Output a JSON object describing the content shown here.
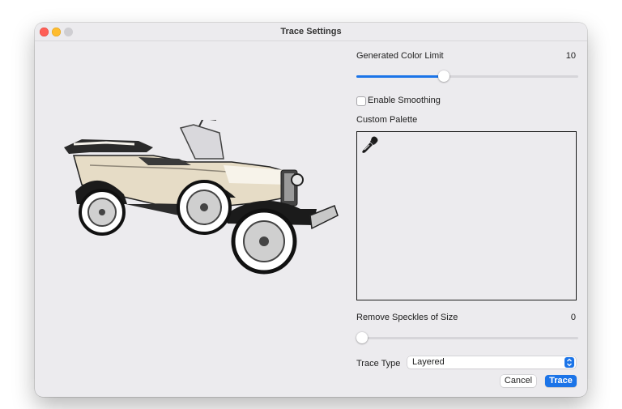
{
  "window": {
    "title": "Trace Settings"
  },
  "color_limit": {
    "label": "Generated Color Limit",
    "value": "10",
    "fraction": 0.39
  },
  "smoothing": {
    "label": "Enable Smoothing",
    "checked": false
  },
  "palette": {
    "label": "Custom Palette",
    "tool_icon": "eyedropper-icon"
  },
  "speckles": {
    "label": "Remove Speckles of Size",
    "value": "0",
    "fraction": 0.0
  },
  "trace_type": {
    "label": "Trace Type",
    "selected": "Layered"
  },
  "buttons": {
    "cancel": "Cancel",
    "trace": "Trace"
  },
  "colors": {
    "accent": "#1b74e8",
    "window_bg": "#ecebee"
  }
}
